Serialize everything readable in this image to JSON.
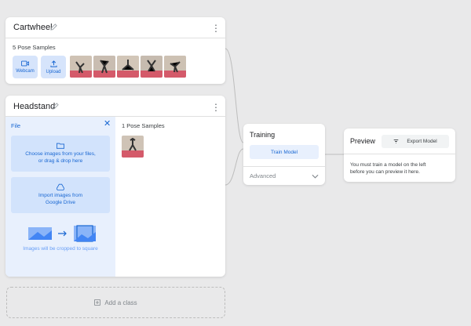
{
  "classes": [
    {
      "name": "Cartwheel",
      "samples_label": "5 Pose Samples",
      "sources": [
        {
          "label": "Webcam",
          "icon": "webcam-icon"
        },
        {
          "label": "Upload",
          "icon": "upload-icon"
        }
      ],
      "sample_count": 5
    },
    {
      "name": "Headstand",
      "samples_label": "1 Pose Samples",
      "sample_count": 1,
      "upload_panel": {
        "title": "File",
        "drop_text_line1": "Choose images from your files,",
        "drop_text_line2": "or drag & drop here",
        "drive_text_line1": "Import images from",
        "drive_text_line2": "Google Drive",
        "crop_note": "Images will be cropped to square"
      }
    }
  ],
  "add_class_label": "Add a class",
  "training": {
    "title": "Training",
    "train_button": "Train Model",
    "advanced_label": "Advanced"
  },
  "preview": {
    "title": "Preview",
    "export_button": "Export Model",
    "message_line1": "You must train a model on the left",
    "message_line2": "before you can preview it here."
  },
  "colors": {
    "accent": "#1967d2",
    "accent_light": "#e8f0fd",
    "background": "#e9e9ea"
  }
}
